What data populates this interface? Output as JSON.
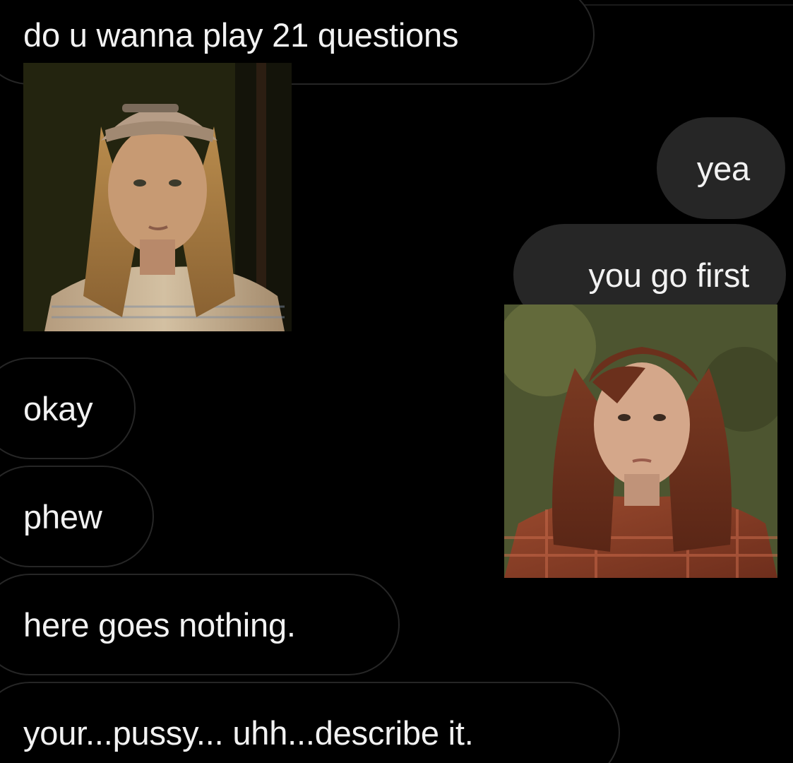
{
  "messages": {
    "m1": "do u wanna play 21 questions",
    "m2": "yea",
    "m3": "you go first",
    "m4": "okay",
    "m5": "phew",
    "m6": "here goes nothing.",
    "m7": "your...pussy... uhh...describe it."
  },
  "photos": {
    "photo1": {
      "subject": "young person with long wavy blond hair, backwards cap, striped shirt"
    },
    "photo2": {
      "subject": "young woman with long auburn hair, plaid flannel shirt"
    }
  },
  "colors": {
    "background": "#000000",
    "incoming_border": "#262626",
    "outgoing_fill": "#262626",
    "text": "#f2f2f2"
  }
}
